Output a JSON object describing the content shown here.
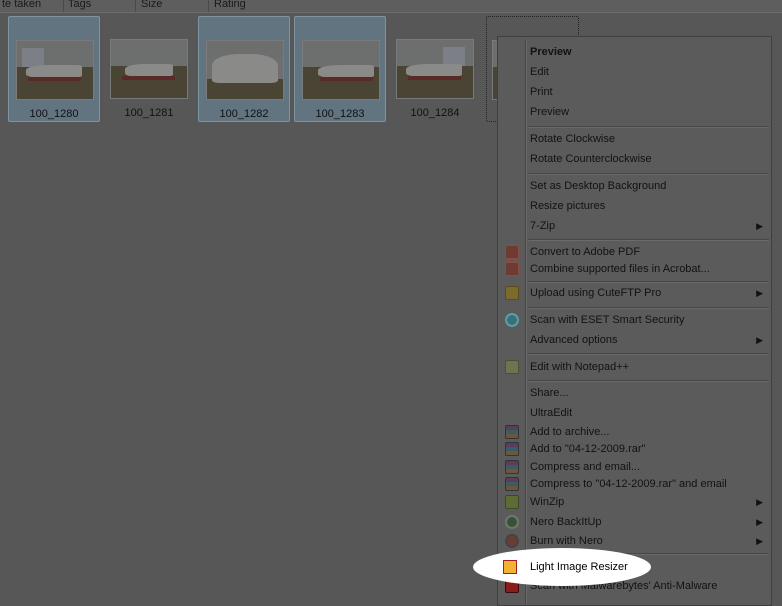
{
  "columns": [
    "te taken",
    "Tags",
    "Size",
    "Rating"
  ],
  "thumbnails": [
    {
      "label": "100_1280",
      "selected": true
    },
    {
      "label": "100_1281",
      "selected": false
    },
    {
      "label": "100_1282",
      "selected": true
    },
    {
      "label": "100_1283",
      "selected": true
    },
    {
      "label": "100_1284",
      "selected": false
    },
    {
      "label": "",
      "selected": false
    }
  ],
  "menu": {
    "items": [
      {
        "label": "Preview",
        "bold": true
      },
      {
        "label": "Edit"
      },
      {
        "label": "Print"
      },
      {
        "label": "Preview"
      },
      {
        "label": "Rotate Clockwise"
      },
      {
        "label": "Rotate Counterclockwise"
      },
      {
        "label": "Set as Desktop Background"
      },
      {
        "label": "Resize pictures"
      },
      {
        "label": "7-Zip",
        "submenu": true
      },
      {
        "label": "Convert to Adobe PDF",
        "icon": "pdf-icon"
      },
      {
        "label": "Combine supported files in Acrobat...",
        "icon": "pdf-combine-icon"
      },
      {
        "label": "Upload using CuteFTP Pro",
        "icon": "cuteftp-icon",
        "submenu": true
      },
      {
        "label": "Scan with ESET Smart Security",
        "icon": "eset-icon"
      },
      {
        "label": "Advanced options",
        "submenu": true
      },
      {
        "label": "Edit with Notepad++",
        "icon": "notepadpp-icon"
      },
      {
        "label": "Share..."
      },
      {
        "label": "UltraEdit"
      },
      {
        "label": "Add to archive...",
        "icon": "winrar-icon"
      },
      {
        "label": "Add to \"04-12-2009.rar\"",
        "icon": "winrar-icon"
      },
      {
        "label": "Compress and email...",
        "icon": "winrar-icon"
      },
      {
        "label": "Compress to \"04-12-2009.rar\" and email",
        "icon": "winrar-icon"
      },
      {
        "label": "WinZip",
        "icon": "winzip-icon",
        "submenu": true
      },
      {
        "label": "Nero BackItUp",
        "icon": "nero-icon",
        "submenu": true
      },
      {
        "label": "Burn with Nero",
        "icon": "burn-icon",
        "submenu": true
      },
      {
        "label": "Light Image Resizer",
        "icon": "light-image-resizer-icon",
        "highlighted": true
      },
      {
        "label": "Scan with Malwarebytes' Anti-Malware",
        "icon": "malwarebytes-icon"
      }
    ]
  },
  "arrow_glyph": "▶"
}
